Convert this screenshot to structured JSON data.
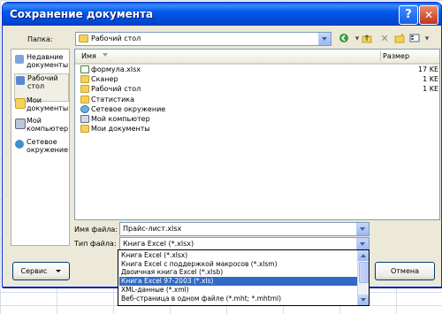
{
  "window": {
    "title": "Сохранение документа",
    "help_glyph": "?",
    "close_glyph": "✕"
  },
  "location": {
    "label": "Папка:",
    "value": "Рабочий стол"
  },
  "toolbar": {
    "icons": [
      "back-icon",
      "up-folder-icon",
      "delete-icon",
      "new-folder-icon",
      "views-icon"
    ]
  },
  "places": [
    {
      "label": "Недавние документы"
    },
    {
      "label": "Рабочий стол"
    },
    {
      "label": "Мои документы"
    },
    {
      "label": "Мой компьютер"
    },
    {
      "label": "Сетевое окружение"
    }
  ],
  "filelist": {
    "columns": {
      "name": "Имя",
      "size": "Размер"
    },
    "rows": [
      {
        "name": "формула.xlsx",
        "size": "17 KE",
        "type": "xls"
      },
      {
        "name": "Сканер",
        "size": "1 KE",
        "type": "folder"
      },
      {
        "name": "Рабочий стол",
        "size": "1 KE",
        "type": "folder"
      },
      {
        "name": "Статистика",
        "size": "",
        "type": "folder"
      },
      {
        "name": "Сетевое окружение",
        "size": "",
        "type": "net"
      },
      {
        "name": "Мой компьютер",
        "size": "",
        "type": "pc"
      },
      {
        "name": "Мои документы",
        "size": "",
        "type": "folder"
      }
    ]
  },
  "filename": {
    "label": "Имя файла:",
    "value": "Прайс-лист.xlsx"
  },
  "filetype": {
    "label": "Тип файла:",
    "value": "Книга Excel (*.xlsx)",
    "options": [
      "Книга Excel (*.xlsx)",
      "Книга Excel с поддержкой макросов (*.xlsm)",
      "Двоичная книга Excel (*.xlsb)",
      "Книга Excel 97-2003 (*.xls)",
      "XML-данные (*.xml)",
      "Веб-страница в одном файле (*.mht; *.mhtml)"
    ],
    "selected_index": 3
  },
  "buttons": {
    "service": "Сервис",
    "cancel": "Отмена"
  }
}
